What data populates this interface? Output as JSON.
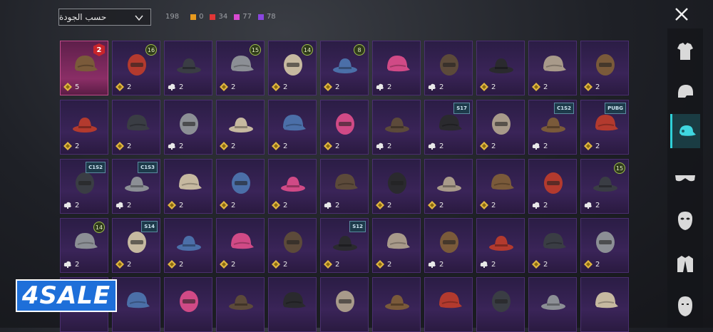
{
  "header": {
    "sort_label": "حسب الجودة",
    "total_count": "198",
    "quality_counts": [
      {
        "color": "#e89a1e",
        "count": "0"
      },
      {
        "color": "#e03636",
        "count": "34"
      },
      {
        "color": "#d94ad0",
        "count": "77"
      },
      {
        "color": "#8a46e0",
        "count": "78"
      }
    ]
  },
  "sidebar": {
    "categories": [
      {
        "icon": "outfit-icon",
        "active": false
      },
      {
        "icon": "helmet-icon",
        "active": false
      },
      {
        "icon": "cap-icon",
        "active": true
      },
      {
        "icon": "glasses-icon",
        "active": false
      },
      {
        "icon": "mask-icon",
        "active": false
      },
      {
        "icon": "jacket-icon",
        "active": false
      },
      {
        "icon": "face-icon",
        "active": false
      }
    ]
  },
  "watermark": "4SALE",
  "items": [
    {
      "name": "bunny-mask",
      "qty": "5",
      "icon": "coin",
      "rarity": "legend",
      "badge": {
        "type": "rank",
        "text": "2"
      }
    },
    {
      "name": "bandana-goggles",
      "qty": "2",
      "icon": "coin",
      "badge": {
        "type": "lvl",
        "text": "16"
      }
    },
    {
      "name": "tactical-helmet",
      "qty": "2",
      "icon": "cloud"
    },
    {
      "name": "red-hair",
      "qty": "2",
      "icon": "coin",
      "badge": {
        "type": "lvl",
        "text": "15"
      }
    },
    {
      "name": "brown-hair-ears",
      "qty": "2",
      "icon": "coin",
      "badge": {
        "type": "lvl",
        "text": "14"
      }
    },
    {
      "name": "green-skull-hood",
      "qty": "2",
      "icon": "coin",
      "badge": {
        "type": "lvl",
        "text": "8"
      }
    },
    {
      "name": "blue-cap",
      "qty": "2",
      "icon": "cloud"
    },
    {
      "name": "green-visor-helmet",
      "qty": "2",
      "icon": "cloud"
    },
    {
      "name": "orange-visor-helmet",
      "qty": "2",
      "icon": "coin"
    },
    {
      "name": "goggle-cap",
      "qty": "2",
      "icon": "coin"
    },
    {
      "name": "red-white-cap",
      "qty": "2",
      "icon": "coin"
    },
    {
      "name": "horned-hair",
      "qty": "2",
      "icon": "coin"
    },
    {
      "name": "white-sun-hat",
      "qty": "2",
      "icon": "coin"
    },
    {
      "name": "fox-ears",
      "qty": "2",
      "icon": "cloud"
    },
    {
      "name": "beanie",
      "qty": "2",
      "icon": "coin"
    },
    {
      "name": "black-cap",
      "qty": "2",
      "icon": "coin"
    },
    {
      "name": "red-gold-cap",
      "qty": "2",
      "icon": "coin"
    },
    {
      "name": "red-hair-cap",
      "qty": "2",
      "icon": "cloud"
    },
    {
      "name": "spiked-helmet",
      "qty": "2",
      "icon": "cloud",
      "badge": {
        "type": "tag",
        "text": "S17"
      }
    },
    {
      "name": "red-fez",
      "qty": "2",
      "icon": "coin"
    },
    {
      "name": "striped-hat",
      "qty": "2",
      "icon": "cloud",
      "badge": {
        "type": "tag",
        "text": "C1S2"
      }
    },
    {
      "name": "silver-hair",
      "qty": "2",
      "icon": "coin",
      "badge": {
        "type": "tag",
        "text": "PUBG"
      }
    },
    {
      "name": "chef-gas-mask",
      "qty": "2",
      "icon": "cloud",
      "badge": {
        "type": "tag",
        "text": "C1S2"
      }
    },
    {
      "name": "horse-head",
      "qty": "2",
      "icon": "cloud",
      "badge": {
        "type": "tag",
        "text": "C1S3"
      }
    },
    {
      "name": "racing-helmet",
      "qty": "2",
      "icon": "coin"
    },
    {
      "name": "football-helmet",
      "qty": "2",
      "icon": "coin"
    },
    {
      "name": "cowboy-hat",
      "qty": "2",
      "icon": "coin"
    },
    {
      "name": "dreadlock-hat",
      "qty": "2",
      "icon": "cloud"
    },
    {
      "name": "grey-cap",
      "qty": "2",
      "icon": "coin"
    },
    {
      "name": "gas-mask-helmet",
      "qty": "2",
      "icon": "coin"
    },
    {
      "name": "black-fedora",
      "qty": "2",
      "icon": "coin"
    },
    {
      "name": "pink-visor-helmet",
      "qty": "2",
      "icon": "cloud"
    },
    {
      "name": "aviator-helmet",
      "qty": "2",
      "icon": "cloud",
      "badge": {
        "type": "lvl",
        "text": "15"
      }
    },
    {
      "name": "police-cap",
      "qty": "2",
      "icon": "cloud",
      "badge": {
        "type": "lvl",
        "text": "14"
      }
    },
    {
      "name": "ninja-helmet",
      "qty": "2",
      "icon": "coin",
      "badge": {
        "type": "tag",
        "text": "S14"
      }
    },
    {
      "name": "brown-top-hat",
      "qty": "2",
      "icon": "coin"
    },
    {
      "name": "white-turban",
      "qty": "2",
      "icon": "coin"
    },
    {
      "name": "pink-cap",
      "qty": "2",
      "icon": "coin"
    },
    {
      "name": "space-helmet",
      "qty": "2",
      "icon": "coin",
      "badge": {
        "type": "tag",
        "text": "S12"
      }
    },
    {
      "name": "blue-ears",
      "qty": "2",
      "icon": "coin"
    },
    {
      "name": "grey-gas-mask",
      "qty": "2",
      "icon": "cloud"
    },
    {
      "name": "winter-beanie",
      "qty": "2",
      "icon": "cloud"
    },
    {
      "name": "knit-cap",
      "qty": "2",
      "icon": "coin"
    },
    {
      "name": "pink-beret",
      "qty": "2",
      "icon": "coin"
    },
    {
      "name": "bonnie-hat",
      "qty": "",
      "icon": "none"
    },
    {
      "name": "cat-headphones",
      "qty": "",
      "icon": "none"
    },
    {
      "name": "brown-fedora",
      "qty": "",
      "icon": "none"
    },
    {
      "name": "winter-hat",
      "qty": "",
      "icon": "none"
    },
    {
      "name": "feather-hat",
      "qty": "",
      "icon": "none"
    },
    {
      "name": "tribal-mask",
      "qty": "",
      "icon": "none"
    },
    {
      "name": "dark-mask",
      "qty": "",
      "icon": "none"
    },
    {
      "name": "luchador-mask",
      "qty": "",
      "icon": "none"
    },
    {
      "name": "shark-hood",
      "qty": "",
      "icon": "none"
    },
    {
      "name": "red-beret",
      "qty": "",
      "icon": "none"
    },
    {
      "name": "grey-fedora",
      "qty": "",
      "icon": "none"
    }
  ]
}
